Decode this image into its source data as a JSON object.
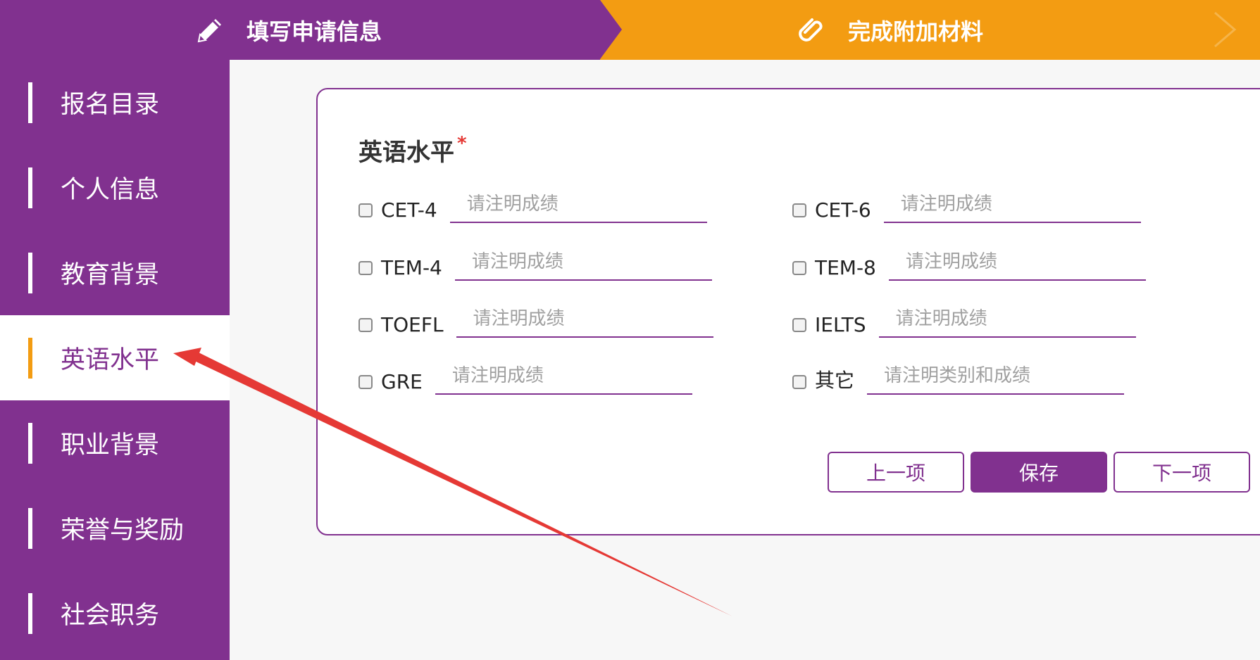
{
  "steps": {
    "step1_label": "填写申请信息",
    "step1_icon": "pencil-icon",
    "step2_label": "完成附加材料",
    "step2_icon": "paperclip-icon"
  },
  "sidebar": {
    "items": [
      {
        "label": "报名目录"
      },
      {
        "label": "个人信息"
      },
      {
        "label": "教育背景"
      },
      {
        "label": "英语水平"
      },
      {
        "label": "职业背景"
      },
      {
        "label": "荣誉与奖励"
      },
      {
        "label": "社会职务"
      }
    ]
  },
  "form": {
    "title": "英语水平",
    "required_mark": "*",
    "options": [
      {
        "label": "CET-4",
        "placeholder": "请注明成绩"
      },
      {
        "label": "CET-6",
        "placeholder": "请注明成绩"
      },
      {
        "label": "TEM-4",
        "placeholder": "请注明成绩"
      },
      {
        "label": "TEM-8",
        "placeholder": "请注明成绩"
      },
      {
        "label": "TOEFL",
        "placeholder": "请注明成绩"
      },
      {
        "label": "IELTS",
        "placeholder": "请注明成绩"
      },
      {
        "label": "GRE",
        "placeholder": "请注明成绩"
      },
      {
        "label": "其它",
        "placeholder": "请注明类别和成绩"
      }
    ],
    "prev_label": "上一项",
    "save_label": "保存",
    "next_label": "下一项"
  },
  "colors": {
    "primary": "#81318f",
    "accent": "#f39c12",
    "annotation_arrow": "#e53935"
  }
}
